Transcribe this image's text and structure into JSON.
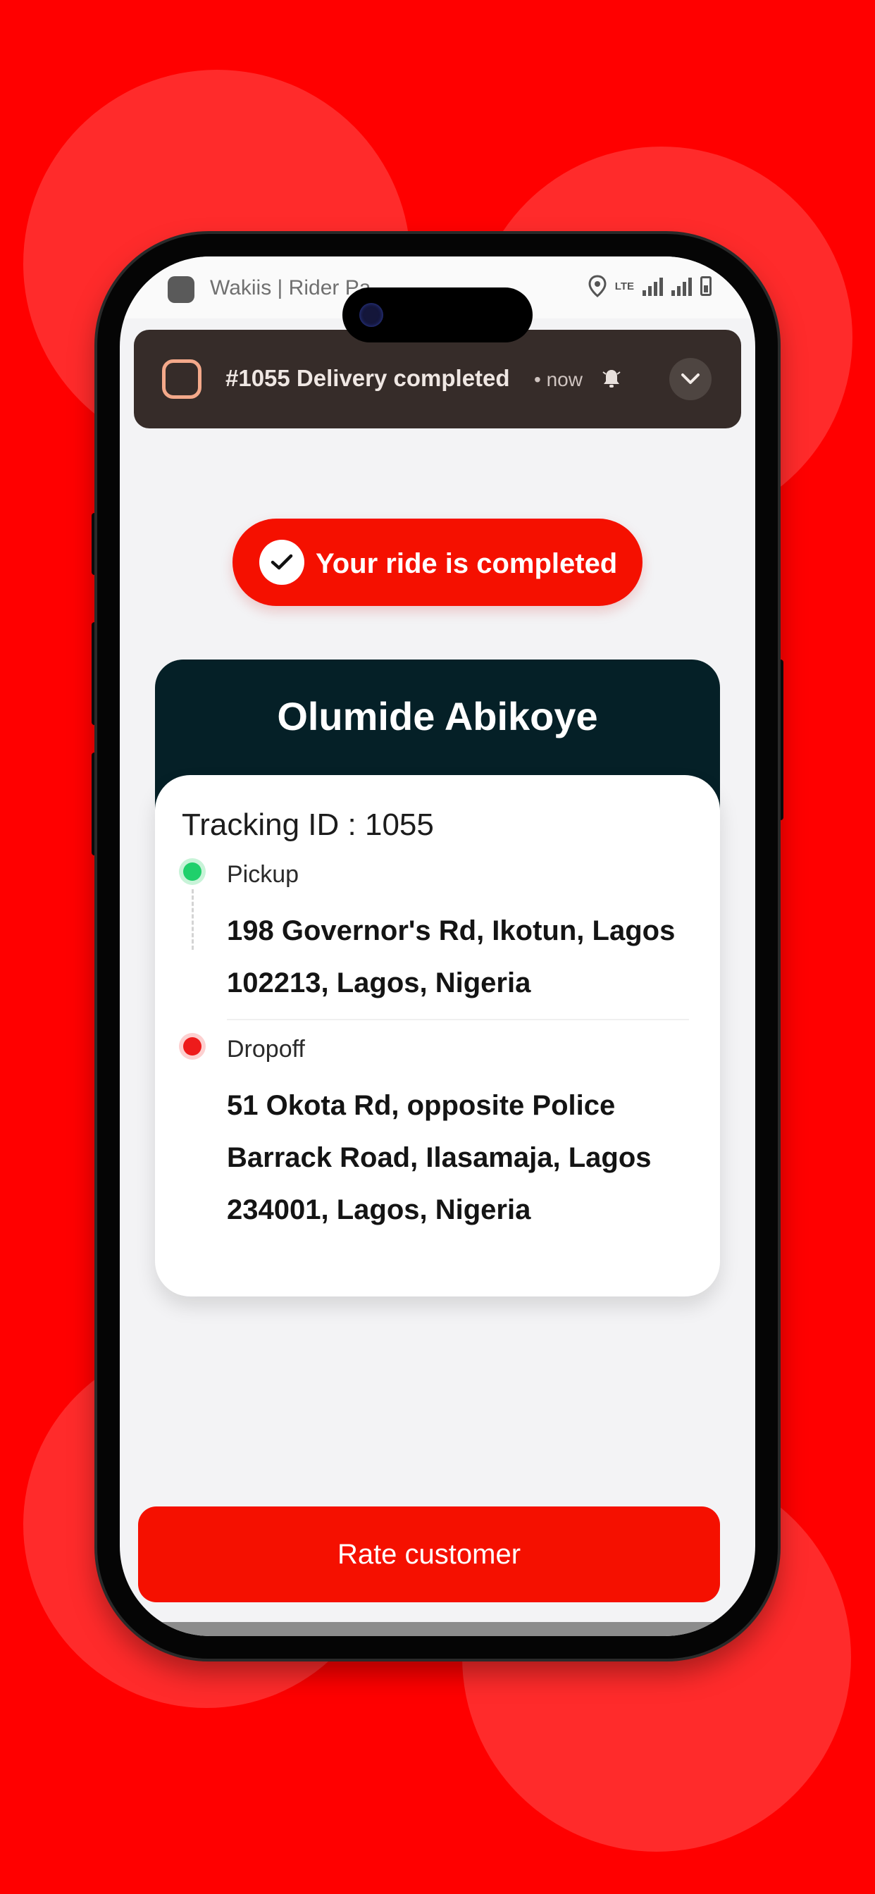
{
  "status_bar": {
    "app_title": "Wakiis | Rider Pa",
    "network": "LTE",
    "icons": [
      "location-icon",
      "signal-icon",
      "battery-icon"
    ]
  },
  "notification": {
    "title": "#1055 Delivery completed",
    "time": "• now",
    "icons": [
      "app-ring-icon",
      "bell-icon",
      "chevron-down-icon"
    ]
  },
  "completion": {
    "label": "Your ride is completed",
    "icon": "check-icon"
  },
  "customer": {
    "name": "Olumide Abikoye"
  },
  "delivery": {
    "tracking": "Tracking ID : 1055",
    "pickup_label": "Pickup",
    "pickup_address": "198 Governor's Rd, Ikotun, Lagos 102213, Lagos, Nigeria",
    "dropoff_label": "Dropoff",
    "dropoff_address": "51 Okota Rd, opposite Police Barrack Road, Ilasamaja, Lagos 234001, Lagos, Nigeria"
  },
  "actions": {
    "rate_label": "Rate customer"
  },
  "colors": {
    "brand_red": "#f51000",
    "background_red": "#ff0000",
    "card_header": "#052027",
    "notification_bg": "#362c29",
    "pickup_green": "#1fd06b",
    "dropoff_red": "#ee1b1b"
  }
}
